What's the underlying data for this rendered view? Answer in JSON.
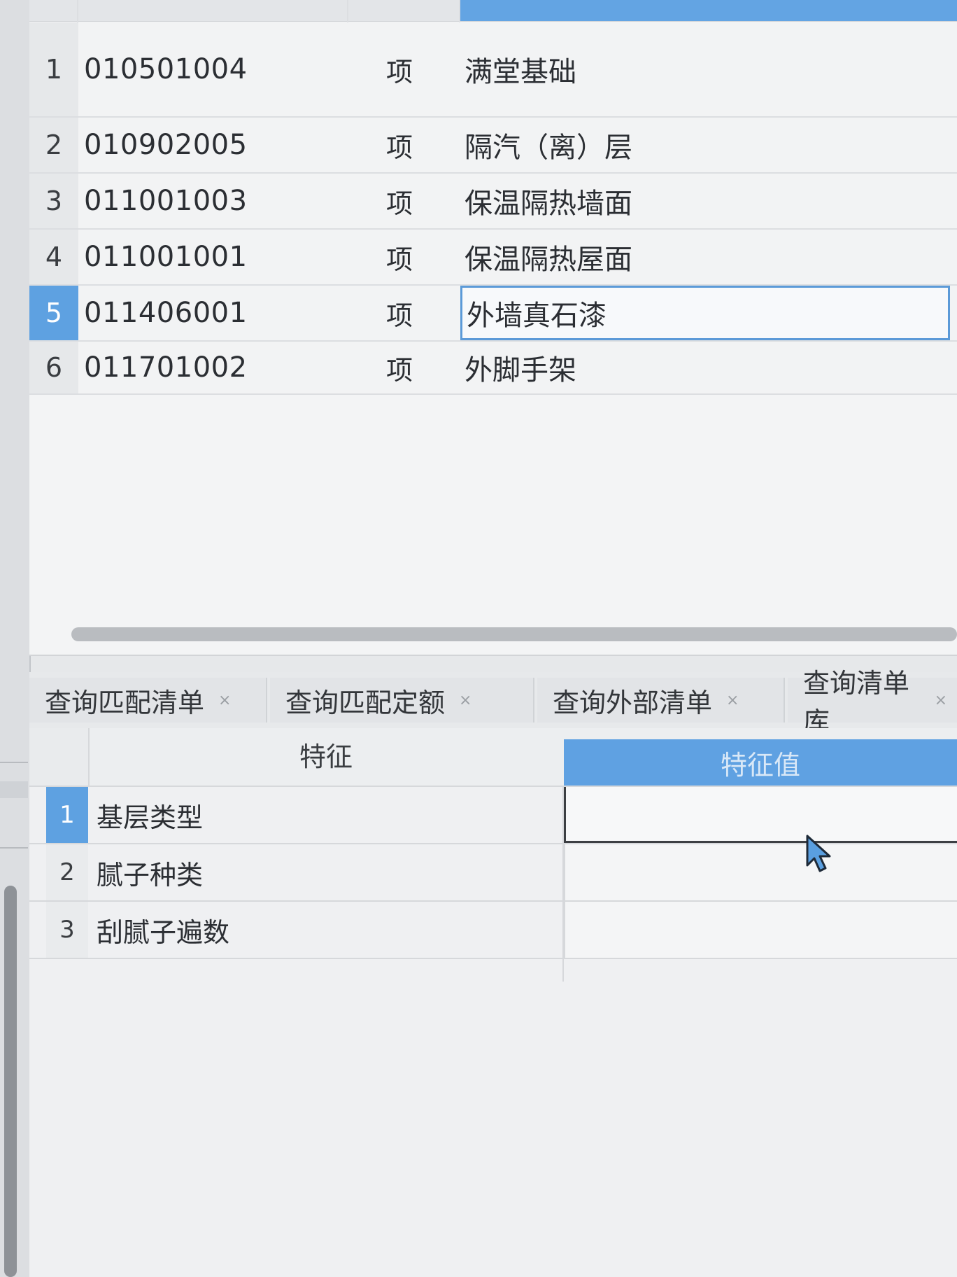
{
  "upper_table": {
    "rows": [
      {
        "num": "1",
        "code": "010501004",
        "type": "项",
        "name": "满堂基础"
      },
      {
        "num": "2",
        "code": "010902005",
        "type": "项",
        "name": "隔汽（离）层"
      },
      {
        "num": "3",
        "code": "011001003",
        "type": "项",
        "name": "保温隔热墙面"
      },
      {
        "num": "4",
        "code": "011001001",
        "type": "项",
        "name": "保温隔热屋面"
      },
      {
        "num": "5",
        "code": "011406001",
        "type": "项",
        "name": "外墙真石漆"
      },
      {
        "num": "6",
        "code": "011701002",
        "type": "项",
        "name": "外脚手架"
      }
    ],
    "selected_row": 5
  },
  "tabs": [
    {
      "label": "查询匹配清单",
      "close": "×"
    },
    {
      "label": "查询匹配定额",
      "close": "×"
    },
    {
      "label": "查询外部清单",
      "close": "×"
    },
    {
      "label": "查询清单库",
      "close": "×"
    }
  ],
  "lower_table": {
    "headers": {
      "feature": "特征",
      "value": "特征值"
    },
    "rows": [
      {
        "num": "1",
        "feature": "基层类型",
        "value": ""
      },
      {
        "num": "2",
        "feature": "腻子种类",
        "value": ""
      },
      {
        "num": "3",
        "feature": "刮腻子遍数",
        "value": ""
      }
    ],
    "selected_row": 1
  },
  "colors": {
    "selection_blue": "#5ea1e1",
    "focus_border": "#5b9ad8"
  }
}
